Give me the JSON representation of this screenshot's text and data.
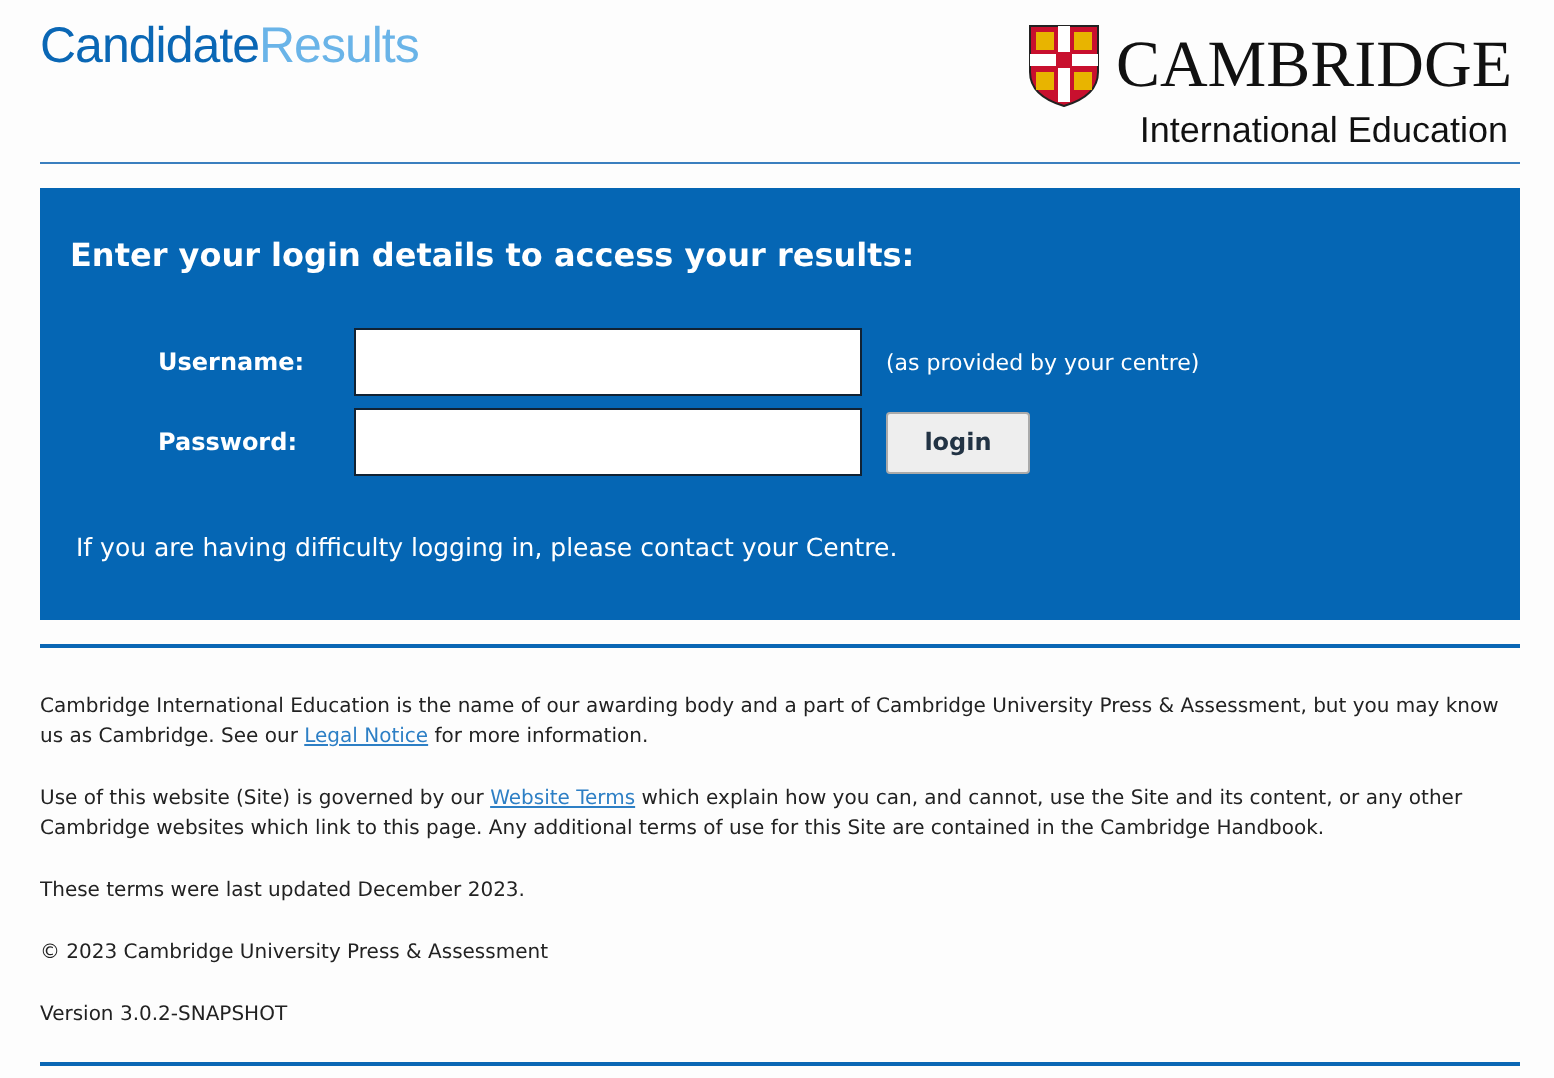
{
  "header": {
    "site_title": {
      "first": "Candidate",
      "second": "Results"
    },
    "brand": {
      "name": "CAMBRIDGE",
      "subtitle": "International Education"
    }
  },
  "login": {
    "heading": "Enter your login details to access your results:",
    "fields": [
      {
        "label": "Username:",
        "hint": "(as provided by your centre)",
        "kind": "text"
      },
      {
        "label": "Password:",
        "kind": "password"
      }
    ],
    "button": "login",
    "help": "If you are having difficulty logging in, please contact your Centre."
  },
  "footer": {
    "paragraphs": [
      {
        "before": "Cambridge International Education is the name of our awarding body and a part of Cambridge University Press & Assessment, but you may know us as Cambridge. See our ",
        "link": "Legal Notice",
        "after": " for more information."
      },
      {
        "before": "Use of this website (Site) is governed by our ",
        "link": "Website Terms",
        "after": " which explain how you can, and cannot, use the Site and its content, or any other Cambridge websites which link to this page. Any additional terms of use for this Site are contained in the Cambridge Handbook."
      },
      {
        "before": "These terms were last updated December 2023."
      },
      {
        "before": "© 2023 Cambridge University Press & Assessment"
      },
      {
        "before": "Version 3.0.2-SNAPSHOT"
      }
    ]
  }
}
